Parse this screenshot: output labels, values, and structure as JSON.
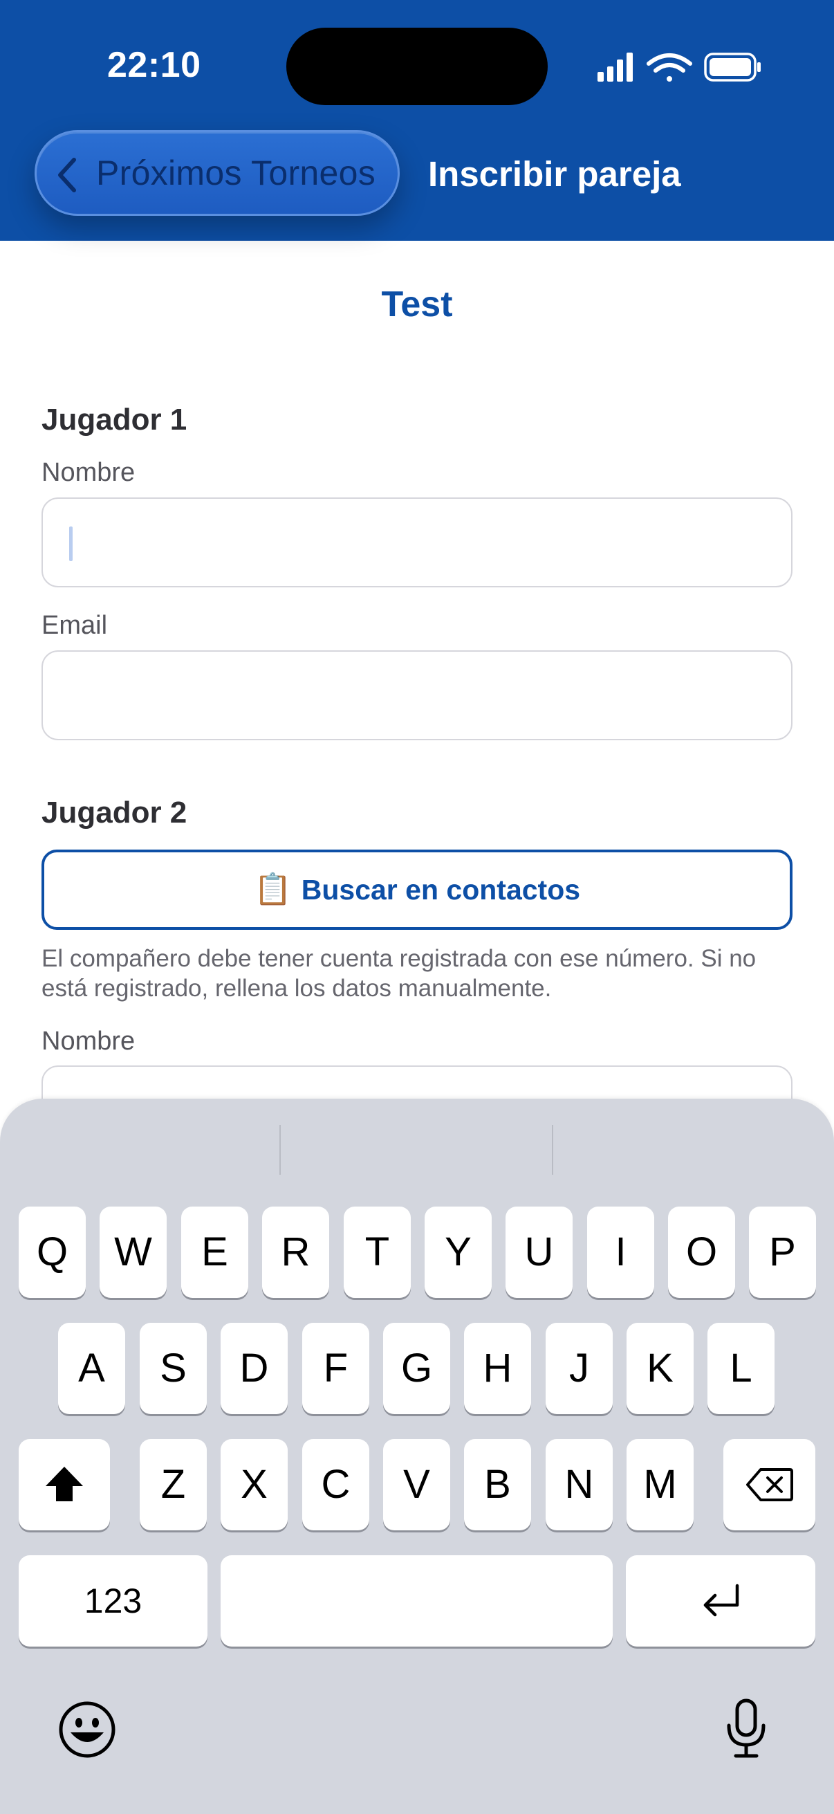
{
  "status_bar": {
    "time": "22:10"
  },
  "nav": {
    "back_label": "Próximos Torneos",
    "title": "Inscribir pareja"
  },
  "form": {
    "tournament_name": "Test",
    "player1": {
      "heading": "Jugador 1",
      "name_label": "Nombre",
      "name_value": "",
      "email_label": "Email",
      "email_value": ""
    },
    "player2": {
      "heading": "Jugador 2",
      "contacts_button": {
        "icon": "📋",
        "label": "Buscar en contactos"
      },
      "helper_text": "El compañero debe tener cuenta registrada con ese número. Si no está registrado, rellena los datos manualmente.",
      "name_label": "Nombre"
    }
  },
  "keyboard": {
    "row1": [
      "Q",
      "W",
      "E",
      "R",
      "T",
      "Y",
      "U",
      "I",
      "O",
      "P"
    ],
    "row2": [
      "A",
      "S",
      "D",
      "F",
      "G",
      "H",
      "J",
      "K",
      "L"
    ],
    "row3": [
      "Z",
      "X",
      "C",
      "V",
      "B",
      "N",
      "M"
    ],
    "numbers_label": "123",
    "icons": {
      "shift": "shift-icon",
      "delete": "delete-icon",
      "return": "return-icon",
      "emoji": "emoji-icon",
      "dictation": "microphone-icon"
    }
  },
  "colors": {
    "header": "#0d4fa6",
    "accent": "#0d4fa6",
    "keyboard_bg": "#d3d6de"
  }
}
